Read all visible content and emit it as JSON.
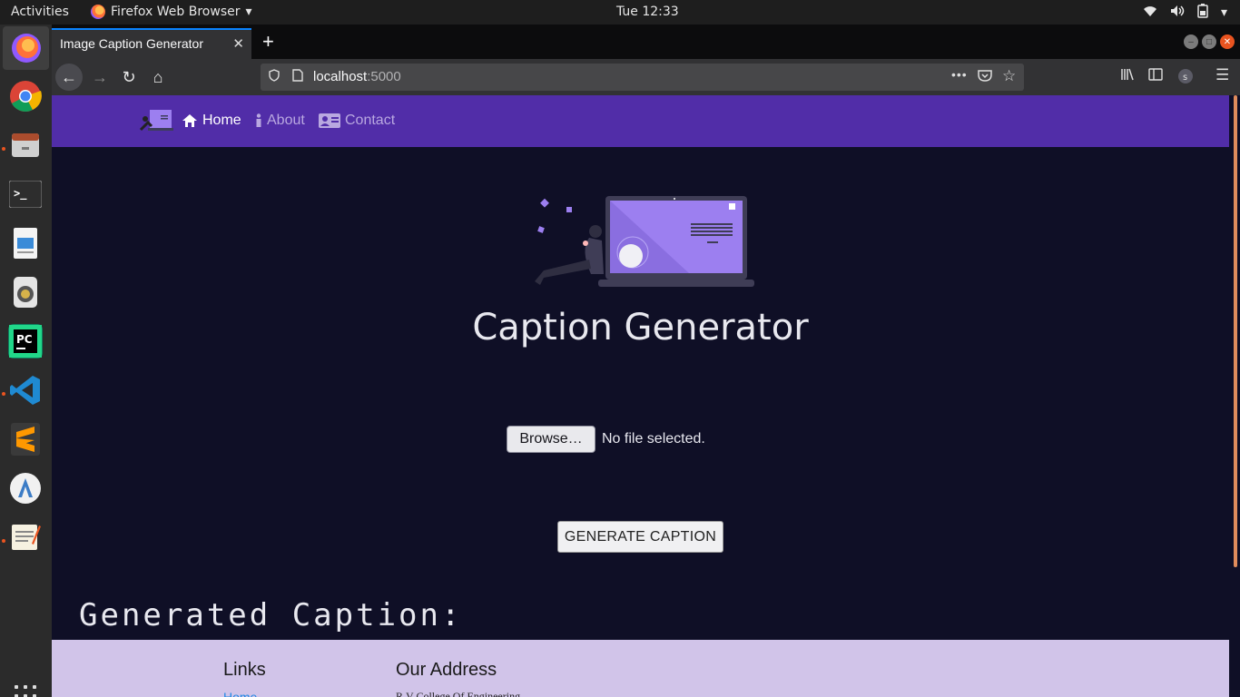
{
  "system": {
    "activities": "Activities",
    "app_menu": "Firefox Web Browser",
    "clock": "Tue 12:33"
  },
  "browser": {
    "tab_title": "Image Caption Generator",
    "url_host": "localhost",
    "url_port": ":5000"
  },
  "site": {
    "nav": {
      "home": "Home",
      "about": "About",
      "contact": "Contact"
    },
    "title": "Caption Generator",
    "browse_label": "Browse…",
    "file_status": "No file selected.",
    "generate_label": "GENERATE CAPTION",
    "caption_heading": "Generated Caption:",
    "footer": {
      "links_heading": "Links",
      "address_heading": "Our Address",
      "home_link": "Home",
      "address_line": "R.V College Of Engineering"
    }
  },
  "colors": {
    "navbar": "#512da8",
    "page_bg": "#0f0f26",
    "footer_bg": "#d1c4e9",
    "accent": "#9c7ff0"
  }
}
